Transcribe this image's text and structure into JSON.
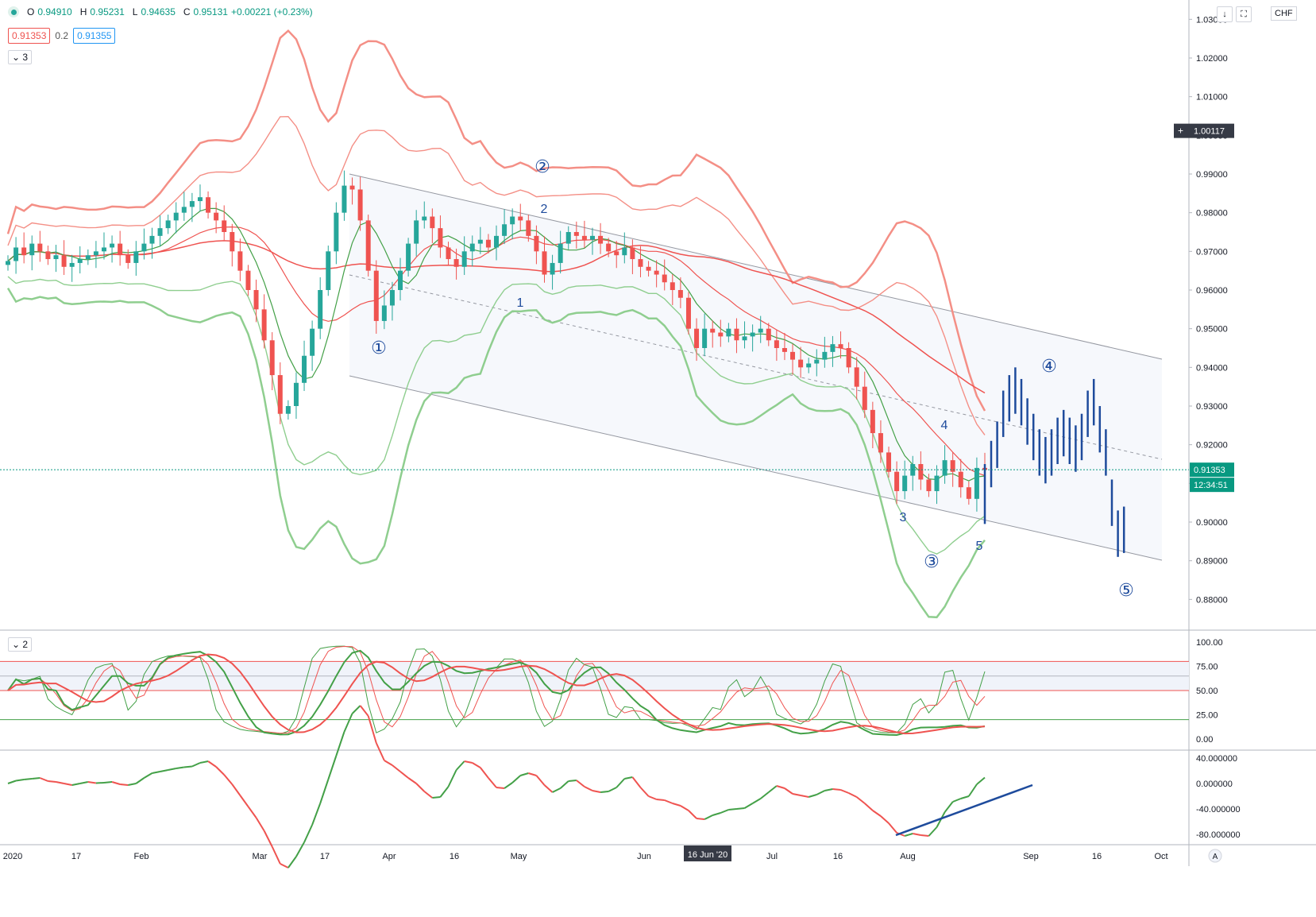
{
  "header": {
    "ohlc": {
      "o_label": "O",
      "o": "0.94910",
      "h_label": "H",
      "h": "0.95231",
      "l_label": "L",
      "l": "0.94635",
      "c_label": "C",
      "c": "0.95131",
      "change": "+0.00221 (+0.23%)"
    },
    "indicator": {
      "left": "0.91353",
      "mid": "0.2",
      "right": "0.91355"
    },
    "collapse_main": "3",
    "collapse_stoch": "2",
    "currency": "CHF",
    "auto_label": "A"
  },
  "colors": {
    "bull": "#26a69a",
    "bear": "#ef5350",
    "wave": "#1e4b9c",
    "axis_text": "#131722"
  },
  "chart_data": [
    {
      "type": "candlestick",
      "symbol_currency": "CHF",
      "x_tick_labels": [
        "2020",
        "17",
        "Feb",
        "Mar",
        "17",
        "Apr",
        "16",
        "May",
        "Jun",
        "16 Jun '20",
        "Jul",
        "16",
        "Aug",
        "Sep",
        "16",
        "Oct"
      ],
      "y_tick_labels": [
        "1.03000",
        "1.02000",
        "1.01000",
        "1.00000",
        "0.99000",
        "0.98000",
        "0.97000",
        "0.96000",
        "0.95000",
        "0.94000",
        "0.93000",
        "0.92000",
        "0.91000",
        "0.90000",
        "0.89000",
        "0.88000"
      ],
      "ylim": [
        0.875,
        1.032
      ],
      "price_labels": {
        "crosshair": "1.00117",
        "last_price": "0.91353",
        "countdown": "12:34:51",
        "crosshair_date": "16 Jun '20"
      },
      "wave_labels": [
        "①",
        "1",
        "②",
        "2",
        "3",
        "③",
        "4",
        "④",
        "5",
        "⑤"
      ],
      "closes": [
        0.9675,
        0.971,
        0.969,
        0.972,
        0.97,
        0.968,
        0.969,
        0.966,
        0.967,
        0.968,
        0.969,
        0.97,
        0.971,
        0.972,
        0.969,
        0.967,
        0.97,
        0.972,
        0.974,
        0.976,
        0.978,
        0.98,
        0.9815,
        0.983,
        0.984,
        0.98,
        0.978,
        0.975,
        0.97,
        0.965,
        0.96,
        0.955,
        0.947,
        0.938,
        0.928,
        0.93,
        0.936,
        0.943,
        0.95,
        0.96,
        0.97,
        0.98,
        0.987,
        0.986,
        0.978,
        0.965,
        0.952,
        0.956,
        0.96,
        0.965,
        0.972,
        0.978,
        0.979,
        0.976,
        0.971,
        0.968,
        0.966,
        0.97,
        0.972,
        0.973,
        0.971,
        0.974,
        0.977,
        0.979,
        0.978,
        0.974,
        0.97,
        0.964,
        0.967,
        0.972,
        0.975,
        0.974,
        0.973,
        0.974,
        0.972,
        0.97,
        0.969,
        0.971,
        0.968,
        0.966,
        0.965,
        0.964,
        0.962,
        0.96,
        0.958,
        0.95,
        0.945,
        0.95,
        0.949,
        0.948,
        0.95,
        0.947,
        0.948,
        0.949,
        0.95,
        0.947,
        0.945,
        0.944,
        0.942,
        0.94,
        0.941,
        0.942,
        0.944,
        0.946,
        0.945,
        0.94,
        0.935,
        0.929,
        0.923,
        0.918,
        0.913,
        0.908,
        0.912,
        0.915,
        0.911,
        0.908,
        0.912,
        0.916,
        0.913,
        0.909,
        0.906,
        0.914,
        0.9135
      ],
      "forecast_bars": [
        0.915,
        0.92,
        0.928,
        0.932,
        0.934,
        0.931,
        0.926,
        0.922,
        0.918,
        0.916,
        0.918,
        0.921,
        0.923,
        0.921,
        0.919,
        0.922,
        0.928,
        0.931,
        0.924,
        0.918,
        0.905,
        0.897,
        0.898
      ]
    },
    {
      "type": "line",
      "name": "stochastic",
      "y_tick_labels": [
        "100.00",
        "75.00",
        "50.00",
        "25.00",
        "0.00"
      ],
      "ylim": [
        0,
        100
      ],
      "levels": [
        80,
        65,
        50,
        20
      ]
    },
    {
      "type": "line",
      "name": "momentum",
      "y_tick_labels": [
        "40.000000",
        "0.000000",
        "-40.000000",
        "-80.000000"
      ],
      "ylim": [
        -95,
        50
      ]
    }
  ]
}
